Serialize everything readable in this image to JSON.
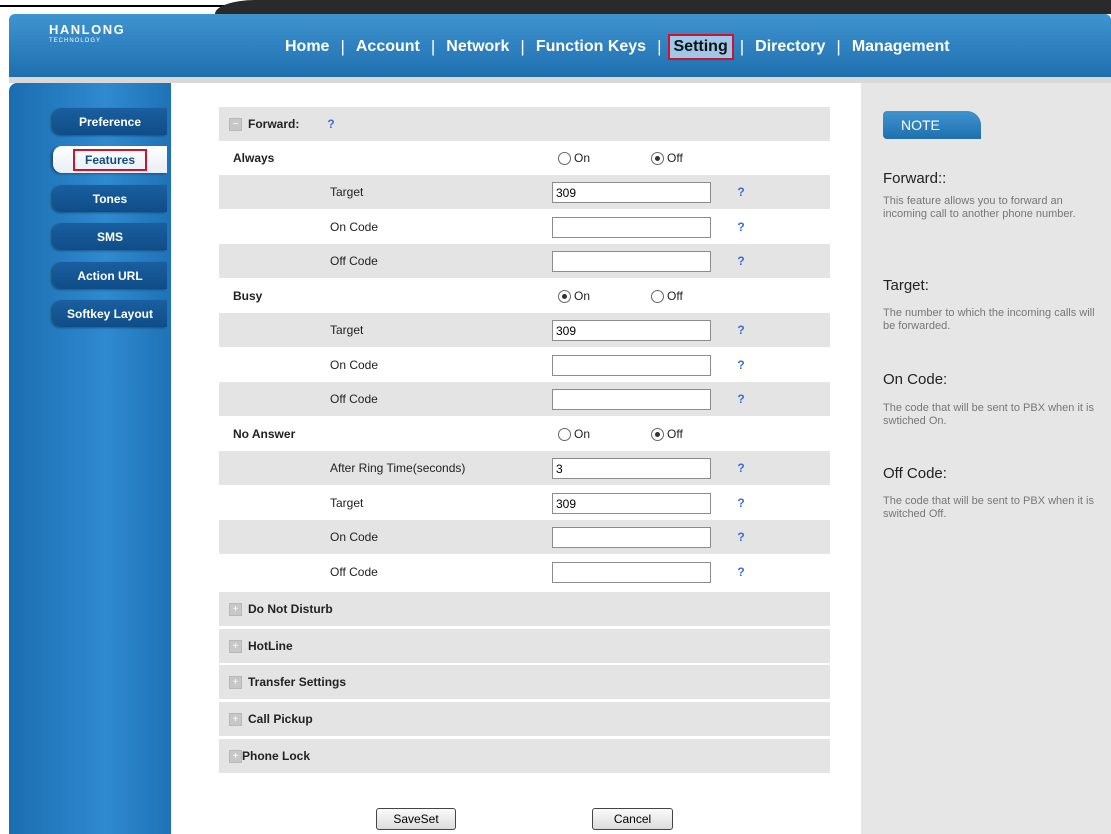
{
  "logo": {
    "brand": "HANLONG",
    "sub": "TECHNOLOGY"
  },
  "nav": [
    "Home",
    "Account",
    "Network",
    "Function Keys",
    "Setting",
    "Directory",
    "Management"
  ],
  "sidebar": [
    "Preference",
    "Features",
    "Tones",
    "SMS",
    "Action URL",
    "Softkey Layout"
  ],
  "forward": {
    "title": "Forward:",
    "help": "?",
    "on_label": "On",
    "off_label": "Off",
    "always": {
      "label": "Always",
      "state": "Off",
      "target_label": "Target",
      "target": "309",
      "on_code_label": "On Code",
      "on_code": "",
      "off_code_label": "Off Code",
      "off_code": ""
    },
    "busy": {
      "label": "Busy",
      "state": "On",
      "target_label": "Target",
      "target": "309",
      "on_code_label": "On Code",
      "on_code": "",
      "off_code_label": "Off Code",
      "off_code": ""
    },
    "no_answer": {
      "label": "No Answer",
      "state": "Off",
      "ring_label": "After Ring Time(seconds)",
      "ring": "3",
      "target_label": "Target",
      "target": "309",
      "on_code_label": "On Code",
      "on_code": "",
      "off_code_label": "Off Code",
      "off_code": ""
    }
  },
  "sections": [
    "Do Not Disturb",
    "HotLine",
    "Transfer Settings",
    "Call Pickup",
    "Phone Lock"
  ],
  "buttons": {
    "save": "SaveSet",
    "cancel": "Cancel"
  },
  "note": {
    "header": "NOTE",
    "items": [
      {
        "title": "Forward::",
        "text": "This feature allows you to forward an incoming call to another phone number."
      },
      {
        "title": "Target:",
        "text": "The number to which the incoming calls will be forwarded."
      },
      {
        "title": "On Code:",
        "text": "The code that will be sent to PBX when it is swtiched On."
      },
      {
        "title": "Off Code:",
        "text": "The code that will be sent to PBX when it is switched Off."
      }
    ]
  },
  "colors": {
    "header_blue": "#2a82c6",
    "highlight_red": "#d0122a",
    "row_shade": "#e4e4e4"
  }
}
